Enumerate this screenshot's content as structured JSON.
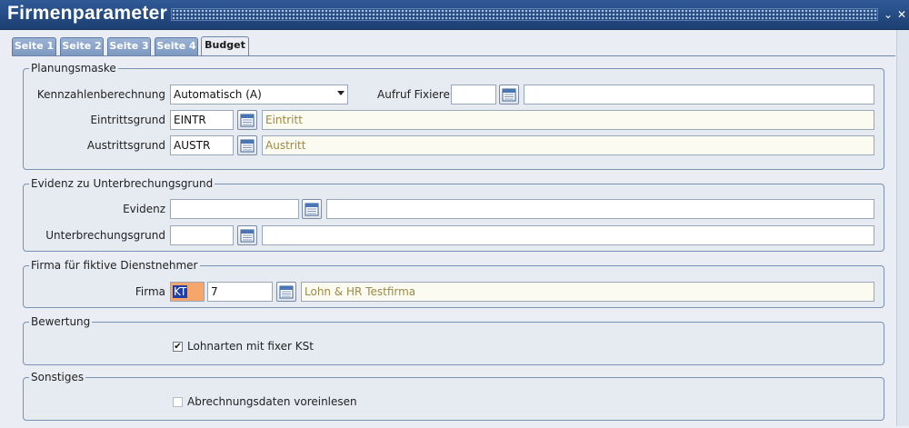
{
  "window": {
    "title": "Firmenparameter",
    "minimize_glyph": "⌄",
    "close_glyph": "✕"
  },
  "tabs": [
    {
      "label": "Seite 1",
      "active": false
    },
    {
      "label": "Seite 2",
      "active": false
    },
    {
      "label": "Seite 3",
      "active": false
    },
    {
      "label": "Seite 4",
      "active": false
    },
    {
      "label": "Budget",
      "active": true
    }
  ],
  "planungsmaske": {
    "legend": "Planungsmaske",
    "kennzahl_label": "Kennzahlenberechnung",
    "kennzahl_value": "Automatisch (A)",
    "aufruf_label": "Aufruf Fixieren",
    "aufruf_code": "",
    "aufruf_desc": "",
    "eintritt_label": "Eintrittsgrund",
    "eintritt_code": "EINTR",
    "eintritt_desc": "Eintritt",
    "austritt_label": "Austrittsgrund",
    "austritt_code": "AUSTR",
    "austritt_desc": "Austritt"
  },
  "evidenz": {
    "legend": "Evidenz zu Unterbrechungsgrund",
    "evidenz_label": "Evidenz",
    "evidenz_code": "",
    "evidenz_desc": "",
    "unterbrechung_label": "Unterbrechungsgrund",
    "unterbrechung_code": "",
    "unterbrechung_desc": ""
  },
  "firma": {
    "legend": "Firma für fiktive Dienstnehmer",
    "firma_label": "Firma",
    "firma_type": "KT",
    "firma_code": "7",
    "firma_desc": "Lohn & HR Testfirma"
  },
  "bewertung": {
    "legend": "Bewertung",
    "checkbox_label": "Lohnarten mit fixer KSt",
    "checked": true,
    "check_glyph": "✔"
  },
  "sonstiges": {
    "legend": "Sonstiges",
    "checkbox_label": "Abrechnungsdaten voreinlesen",
    "checked": false,
    "check_glyph": ""
  },
  "icons": {
    "lookup": "calendar-lookup-icon"
  },
  "colors": {
    "titlebar": "#1d3f73",
    "tab_inactive": "#7d98c0",
    "readonly_text": "#9d8a45",
    "highlight_field": "#f6a66a",
    "selection": "#1f3fa6"
  }
}
